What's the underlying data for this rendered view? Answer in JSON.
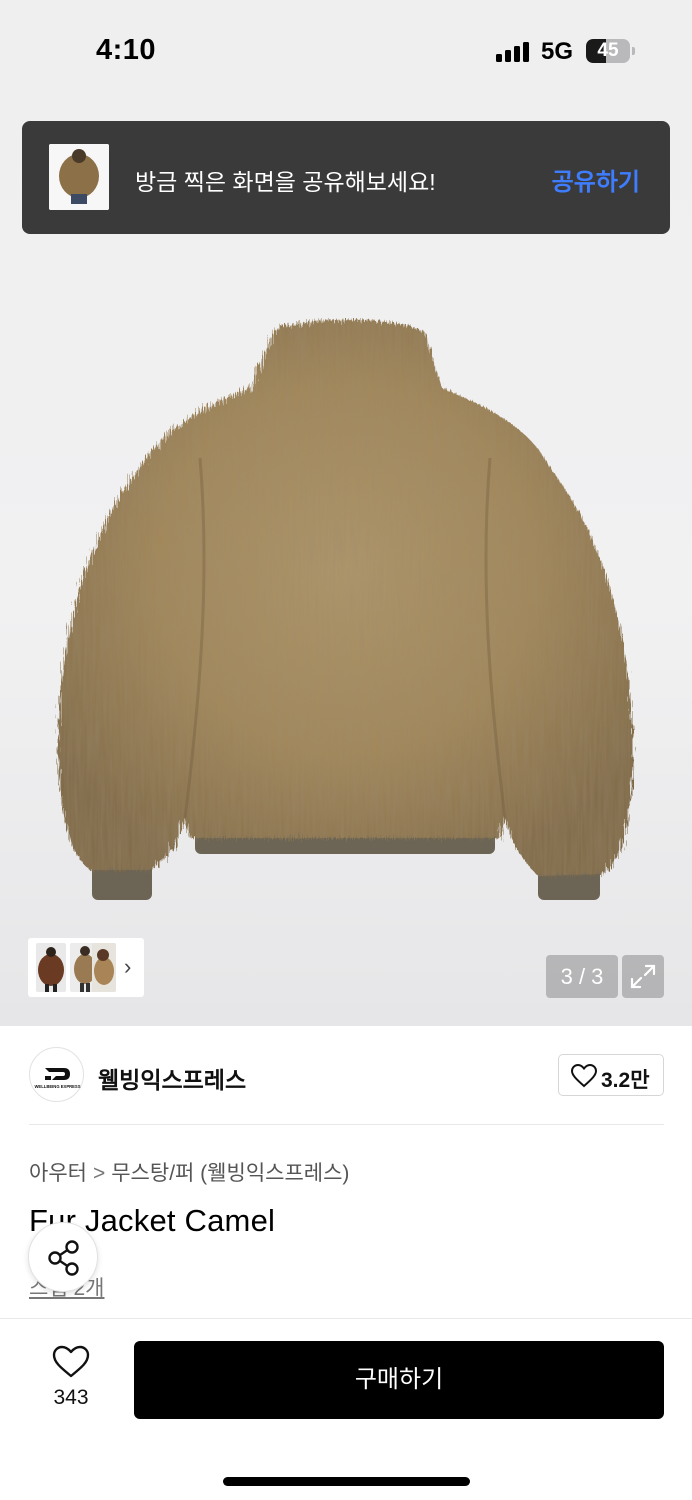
{
  "status_bar": {
    "time": "4:10",
    "network": "5G",
    "battery": "45",
    "battery_level": 0.45
  },
  "toast": {
    "message": "방금 찍은 화면을 공유해보세요!",
    "action_label": "공유하기",
    "action_color": "#3f7dff"
  },
  "gallery": {
    "counter": "3 / 3",
    "thumb_count": 3,
    "thumb_more_icon": "chevron-right-icon",
    "expand_icon": "expand-arrows-icon",
    "fur_color": "#a58a5c",
    "rib_color": "#6c6555"
  },
  "brand": {
    "name": "웰빙익스프레스",
    "logo_text": "WELLBEING EXPRESS",
    "like_icon": "heart-outline-icon",
    "like_count": "3.2만"
  },
  "product": {
    "breadcrumb": [
      "아우터",
      "무스탕/퍼 (웰빙익스프레스)"
    ],
    "breadcrumb_separator": ">",
    "title": "Fur Jacket Camel",
    "review_link": "스냅 2개",
    "share_icon": "share-icon"
  },
  "bottom_bar": {
    "wish_icon": "heart-outline-icon",
    "wish_count": "343",
    "buy_label": "구매하기"
  }
}
